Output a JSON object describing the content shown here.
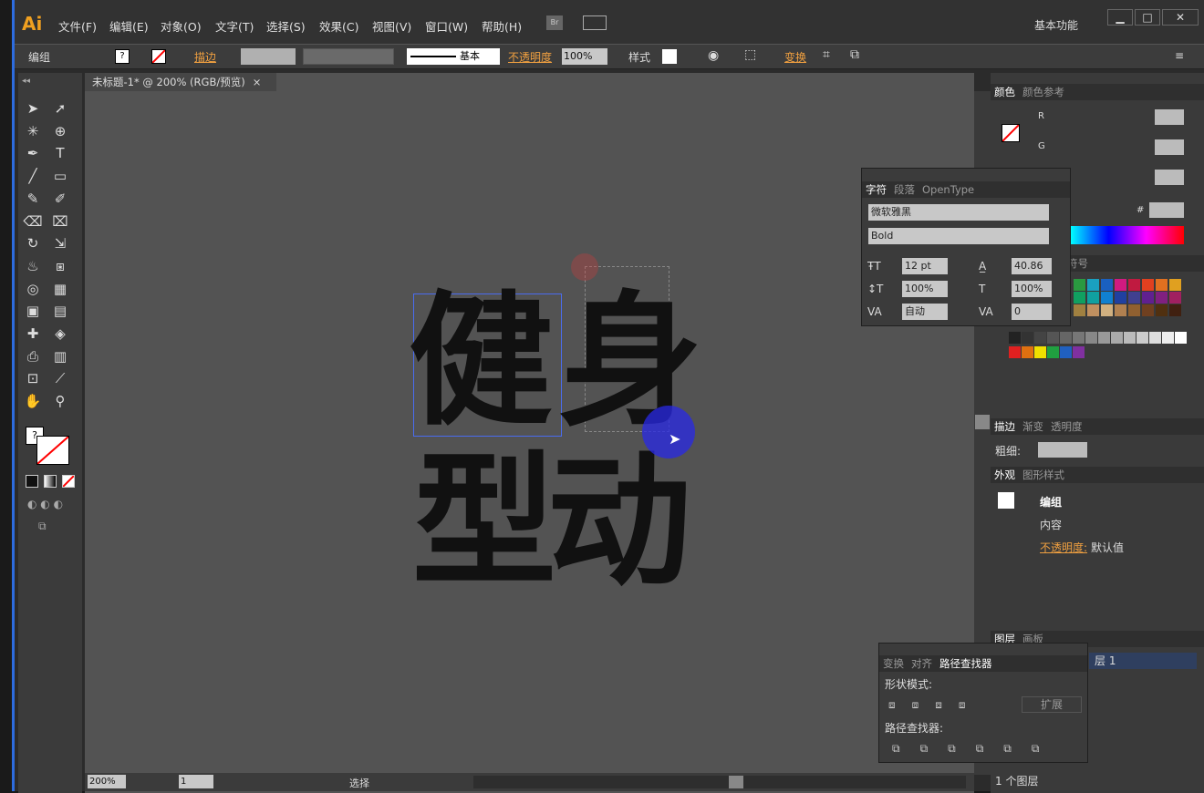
{
  "app": {
    "logo": "Ai",
    "workspace": "基本功能"
  },
  "menu": [
    "文件(F)",
    "编辑(E)",
    "对象(O)",
    "文字(T)",
    "选择(S)",
    "效果(C)",
    "视图(V)",
    "窗口(W)",
    "帮助(H)"
  ],
  "bridge": "Br",
  "control": {
    "selection": "编组",
    "stroke_label": "描边",
    "stroke_style": "基本",
    "opacity_label": "不透明度",
    "opacity_value": "100%",
    "style_label": "样式",
    "transform_label": "变换"
  },
  "document": {
    "tab_title": "未标题-1* @ 200% (RGB/预览)",
    "zoom": "200%",
    "page": "1",
    "status_text": "选择"
  },
  "artwork": {
    "chars": [
      "健",
      "身",
      "型",
      "动"
    ]
  },
  "color_panel": {
    "tabs": [
      "颜色",
      "颜色参考"
    ],
    "channels": [
      "R",
      "G",
      "B"
    ],
    "hex_label": "#"
  },
  "character_panel": {
    "tabs": [
      "字符",
      "段落",
      "OpenType"
    ],
    "font_family": "微软雅黑",
    "font_style": "Bold",
    "size": "12 pt",
    "leading": "40.86",
    "vscale": "100%",
    "hscale": "100%",
    "kerning": "自动",
    "tracking": "0"
  },
  "swatches_panel": {
    "tab_fragment": "符号"
  },
  "stroke_panel": {
    "tabs": [
      "描边",
      "渐变",
      "透明度"
    ],
    "weight_label": "粗细:"
  },
  "appearance_panel": {
    "tabs": [
      "外观",
      "图形样式"
    ],
    "rows": [
      "编组",
      "内容"
    ],
    "opacity_label": "不透明度:",
    "opacity_value": "默认值"
  },
  "layers_panel": {
    "tabs": [
      "图层",
      "画板"
    ],
    "layer_name": "图层 1",
    "layer_fragment": "层 1",
    "count": "1 个图层"
  },
  "pathfinder_panel": {
    "tabs": [
      "变换",
      "对齐",
      "路径查找器"
    ],
    "shape_modes_label": "形状模式:",
    "pathfinders_label": "路径查找器:",
    "expand_label": "扩展"
  },
  "colors": {
    "accent": "#f0a040",
    "selection": "#4a6cf0",
    "spectrum_start": "#ff0000"
  }
}
